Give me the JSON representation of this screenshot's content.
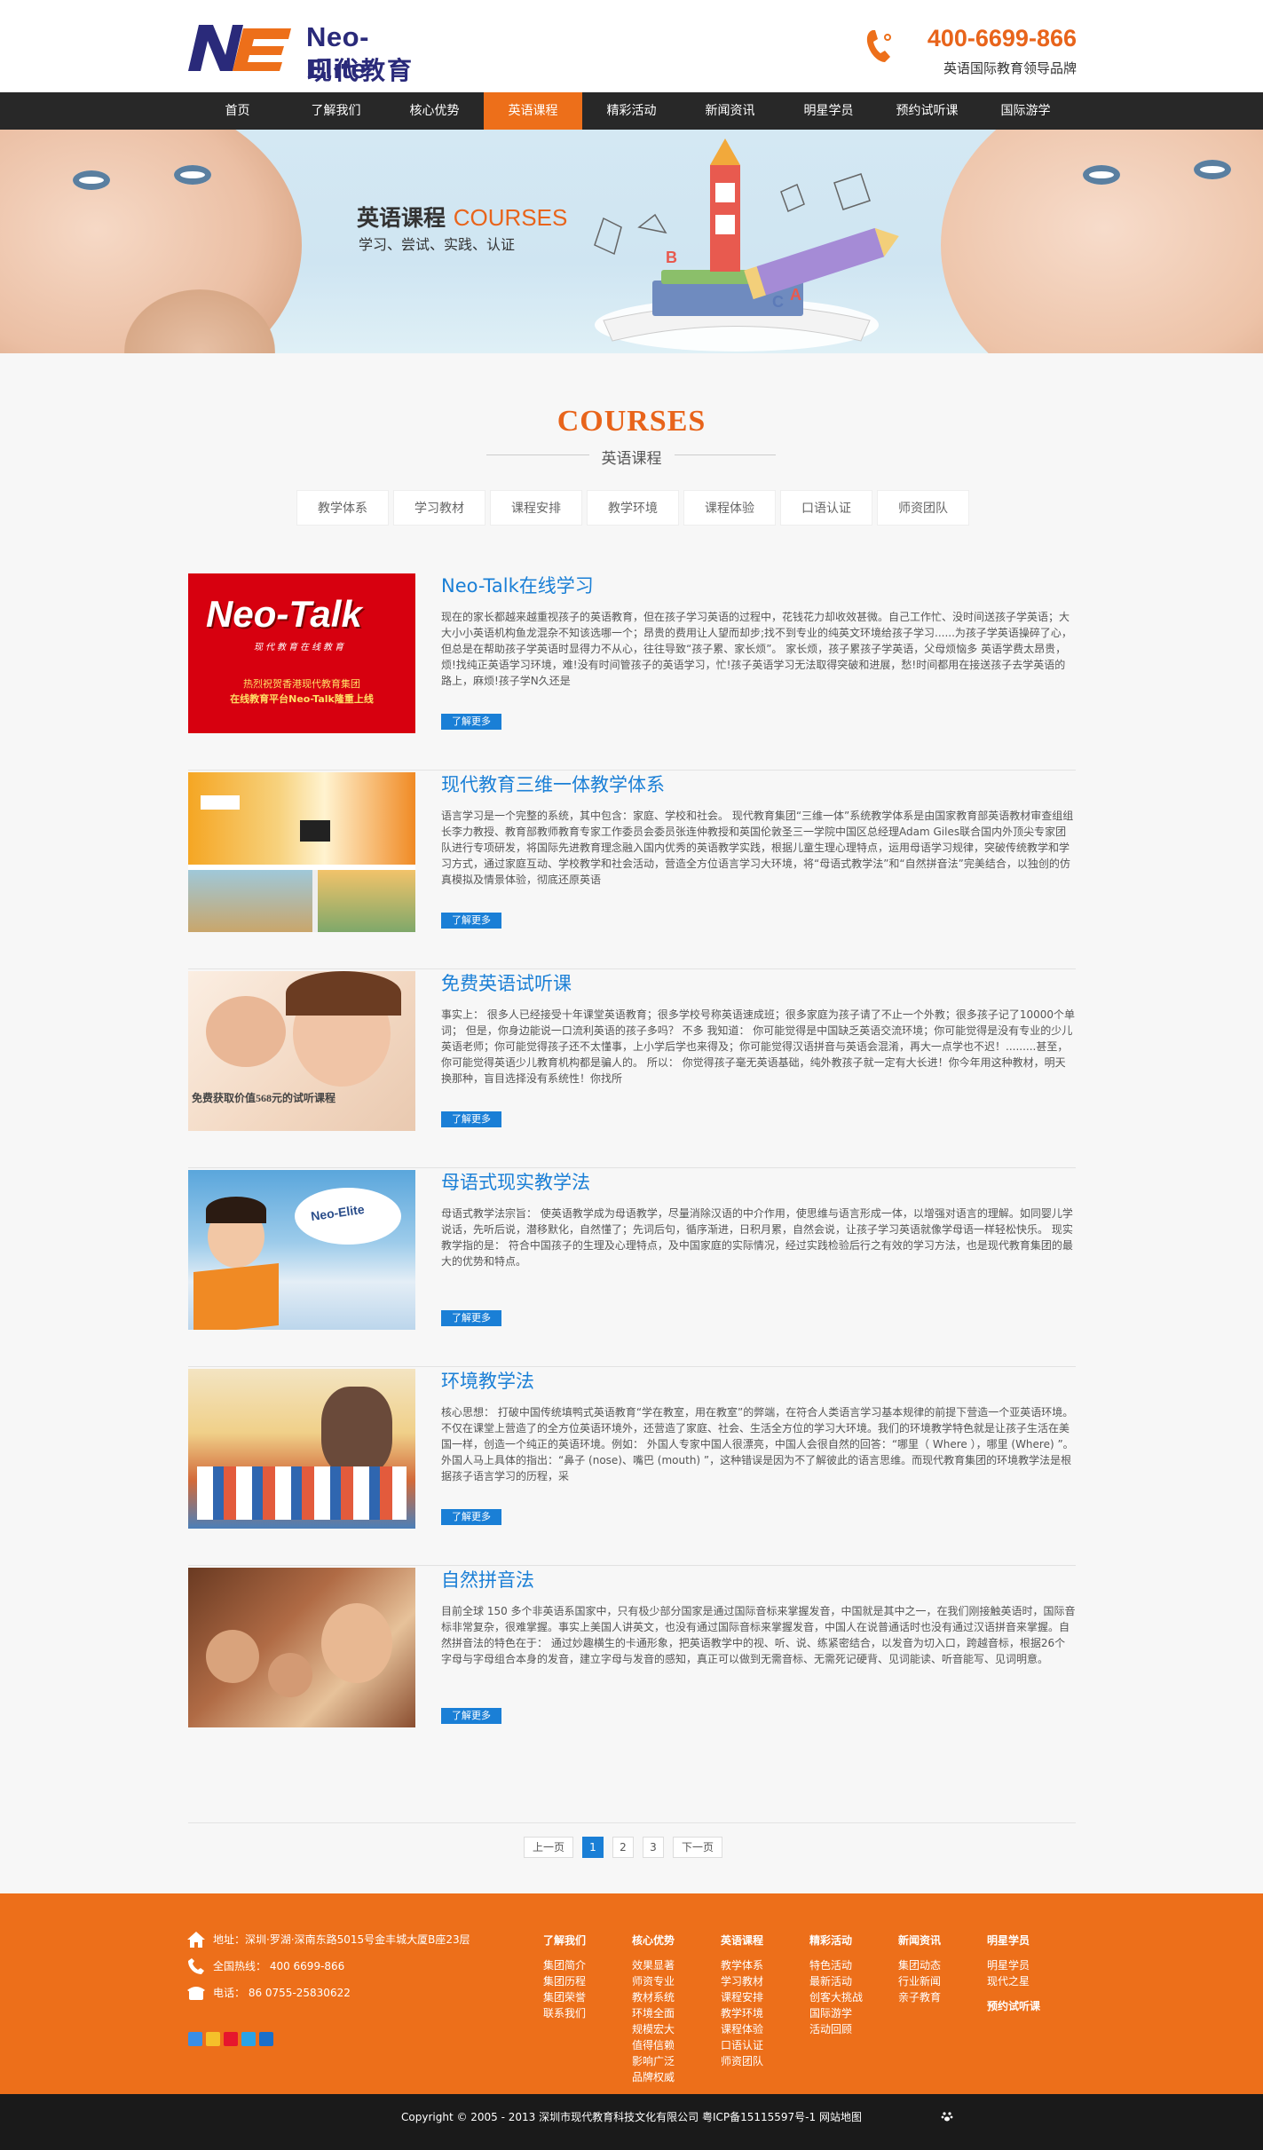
{
  "brand": {
    "name_en": "Neo-Elite",
    "name_cn": "现代教育",
    "colors": {
      "primary": "#ed6f1a",
      "navy": "#2a2a7a",
      "link": "#1a7fd6"
    }
  },
  "hotline": {
    "number": "400-6699-866",
    "slogan": "英语国际教育领导品牌"
  },
  "nav": {
    "items": [
      "首页",
      "了解我们",
      "核心优势",
      "英语课程",
      "精彩活动",
      "新闻资讯",
      "明星学员",
      "预约试听课",
      "国际游学"
    ],
    "active": "英语课程"
  },
  "banner": {
    "title_cn": "英语课程",
    "title_en": "COURSES",
    "subtitle": "学习、尝试、实践、认证"
  },
  "section": {
    "title_en": "COURSES",
    "title_cn": "英语课程"
  },
  "subnav": [
    "教学体系",
    "学习教材",
    "课程安排",
    "教学环境",
    "课程体验",
    "口语认证",
    "师资团队"
  ],
  "courses": [
    {
      "title": "Neo-Talk在线学习",
      "image": "neo-talk-banner",
      "image_text": {
        "logo": "Neo-Talk",
        "tagline": "现代教育在线教育",
        "line1": "热烈祝贺香港现代教育集团",
        "line2": "在线教育平台Neo-Talk隆重上线"
      },
      "desc": "现在的家长都越来越重视孩子的英语教育，但在孩子学习英语的过程中，花钱花力却收效甚微。自己工作忙、没时间送孩子学英语；大大小小英语机构鱼龙混杂不知该选哪一个；昂贵的费用让人望而却步;找不到专业的纯英文环境给孩子学习......为孩子学英语操碎了心，但总是在帮助孩子学英语时显得力不从心，往往导致“孩子累、家长烦”。 家长烦，孩子累孩子学英语，父母烦恼多 英语学费太昂贵，烦!找纯正英语学习环境，难!没有时间管孩子的英语学习，忙!孩子英语学习无法取得突破和进展，愁!时间都用在接送孩子去学英语的路上，麻烦!孩子学N久还是",
      "more": "了解更多"
    },
    {
      "title": "现代教育三维一体教学体系",
      "image": "classroom-photo",
      "desc": "语言学习是一个完整的系统，其中包含：家庭、学校和社会。 现代教育集团“三维一体”系统教学体系是由国家教育部英语教材审查组组长李力教授、教育部教师教育专家工作委员会委员张连仲教授和英国伦敦圣三一学院中国区总经理Adam Giles联合国内外顶尖专家团队进行专项研发，将国际先进教育理念融入国内优秀的英语教学实践，根据儿童生理心理特点，运用母语学习规律，突破传统教学和学习方式，通过家庭互动、学校教学和社会活动，营造全方位语言学习大环境，将“母语式教学法”和“自然拼音法”完美结合，以独创的仿真模拟及情景体验，彻底还原英语",
      "more": "了解更多"
    },
    {
      "title": "免费英语试听课",
      "image": "girl-drawing-photo",
      "image_text": {
        "line1": "免费获取价值568元的试听课程"
      },
      "desc": "事实上： 很多人已经接受十年课堂英语教育；很多学校号称英语速成班；很多家庭为孩子请了不止一个外教；很多孩子记了10000个单词； 但是，你身边能说一口流利英语的孩子多吗？ 不多 我知道： 你可能觉得是中国缺乏英语交流环境；你可能觉得是没有专业的少儿英语老师；你可能觉得孩子还不太懂事，上小学后学也来得及；你可能觉得汉语拼音与英语会混淆，再大一点学也不迟！.........甚至，你可能觉得英语少儿教育机构都是骗人的。 所以： 你觉得孩子毫无英语基础，纯外教孩子就一定有大长进！你今年用这种教材，明天换那种，盲目选择没有系统性！你找所",
      "more": "了解更多"
    },
    {
      "title": "母语式现实教学法",
      "image": "boy-reading-photo",
      "image_text": {
        "sign": "Neo-Elite"
      },
      "desc": "母语式教学法宗旨： 使英语教学成为母语教学，尽量消除汉语的中介作用，使思维与语言形成一体，以增强对语言的理解。如同婴儿学说话，先听后说，潜移默化，自然懂了；先词后句，循序渐进，日积月累，自然会说，让孩子学习英语就像学母语一样轻松快乐。 现实教学指的是： 符合中国孩子的生理及心理特点，及中国家庭的实际情况，经过实践检验后行之有效的学习方法，也是现代教育集团的最大的优势和特点。",
      "more": "了解更多"
    },
    {
      "title": "环境教学法",
      "image": "kids-class-photo",
      "desc": "核心思想： 打破中国传统填鸭式英语教育“学在教室，用在教室”的弊端，在符合人类语言学习基本规律的前提下营造一个亚英语环境。不仅在课堂上营造了的全方位英语环境外，还营造了家庭、社会、生活全方位的学习大环境。我们的环境教学特色就是让孩子生活在美国一样，创造一个纯正的英语环境。例如： 外国人专家中国人很漂亮，中国人会很自然的回答：“哪里（ Where ），哪里 (Where) ”。外国人马上具体的指出：“鼻子 (nose)、嘴巴 (mouth) ”，这种错误是因为不了解彼此的语言思维。而现代教育集团的环境教学法是根据孩子语言学习的历程，采",
      "more": "了解更多"
    },
    {
      "title": "自然拼音法",
      "image": "teacher-kids-photo",
      "desc": "目前全球 150 多个非英语系国家中，只有极少部分国家是通过国际音标来掌握发音，中国就是其中之一，在我们刚接触英语时，国际音标非常复杂，很难掌握。事实上美国人讲英文，也没有通过国际音标来掌握发音，中国人在说普通话时也没有通过汉语拼音来掌握。自然拼音法的特色在于： 通过妙趣横生的卡通形象，把英语教学中的视、听、说、练紧密结合，以发音为切入口，跨越音标，根据26个字母与字母组合本身的发音，建立字母与发音的感知，真正可以做到无需音标、无需死记硬背、见词能读、听音能写、见词明意。",
      "more": "了解更多"
    }
  ],
  "pagination": {
    "prev": "上一页",
    "pages": [
      "1",
      "2",
      "3"
    ],
    "current": "1",
    "next": "下一页"
  },
  "footer": {
    "address": "地址：深圳·罗湖·深南东路5015号金丰城大厦B座23层",
    "hotline": "全国热线： 400 6699-866",
    "phone": "电话： 86 0755-25830622",
    "columns": [
      {
        "head": "了解我们",
        "items": [
          "集团简介",
          "集团历程",
          "集团荣誉",
          "联系我们"
        ]
      },
      {
        "head": "核心优势",
        "items": [
          "效果显著",
          "师资专业",
          "教材系统",
          "环境全面",
          "规模宏大",
          "值得信赖",
          "影响广泛",
          "品牌权威"
        ]
      },
      {
        "head": "英语课程",
        "items": [
          "教学体系",
          "学习教材",
          "课程安排",
          "教学环境",
          "课程体验",
          "口语认证",
          "师资团队"
        ]
      },
      {
        "head": "精彩活动",
        "items": [
          "特色活动",
          "最新活动",
          "创客大挑战",
          "国际游学",
          "活动回顾"
        ]
      },
      {
        "head": "新闻资讯",
        "items": [
          "集团动态",
          "行业新闻",
          "亲子教育"
        ]
      },
      {
        "head": "明星学员",
        "items": [
          "明星学员",
          "现代之星",
          "",
          "预约试听课"
        ]
      }
    ],
    "copyright": "Copyright © 2005 - 2013 深圳市现代教育科技文化有限公司  粤ICP备15115597号-1    网站地图"
  }
}
